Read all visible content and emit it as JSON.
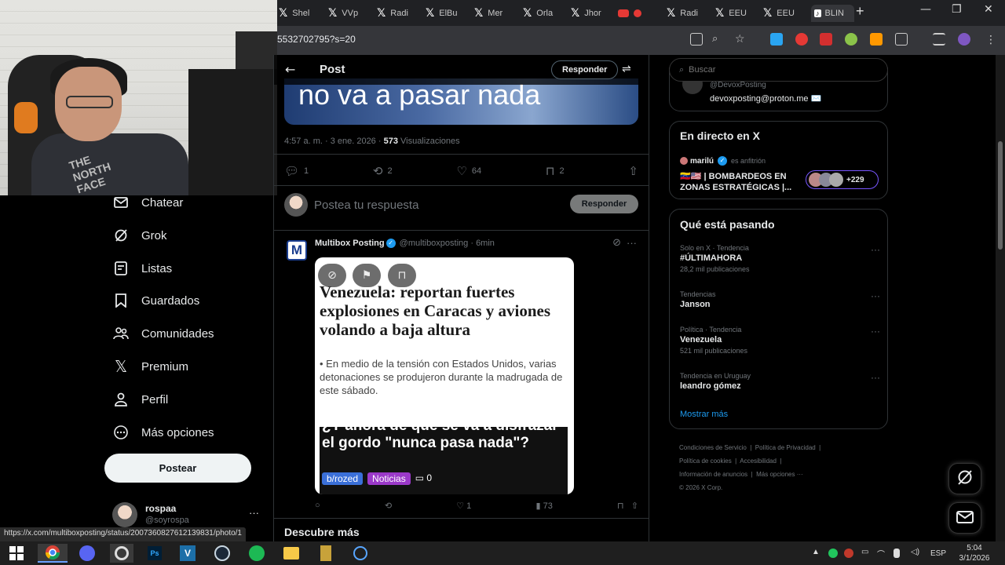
{
  "browser": {
    "tabs": [
      {
        "label": "Shel",
        "icon": "x"
      },
      {
        "label": "VVp",
        "icon": "x"
      },
      {
        "label": "Radi",
        "icon": "x"
      },
      {
        "label": "ElBu",
        "icon": "x"
      },
      {
        "label": "Mer",
        "icon": "x"
      },
      {
        "label": "Orla",
        "icon": "x"
      },
      {
        "label": "Jhor",
        "icon": "x"
      },
      {
        "label": "",
        "icon": "youtube"
      },
      {
        "label": "Radi",
        "icon": "x"
      },
      {
        "label": "EEU",
        "icon": "x"
      },
      {
        "label": "EEU",
        "icon": "x"
      },
      {
        "label": "BLIN",
        "icon": "tiktok"
      }
    ],
    "new_tab": "+",
    "url": "5532702795?s=20",
    "status_link": "https://x.com/multiboxposting/status/2007360827612139831/photo/1"
  },
  "nav": {
    "items": [
      {
        "label": "Chatear",
        "icon": "mail-icon"
      },
      {
        "label": "Grok",
        "icon": "grok-icon"
      },
      {
        "label": "Listas",
        "icon": "list-icon"
      },
      {
        "label": "Guardados",
        "icon": "bookmark-icon"
      },
      {
        "label": "Comunidades",
        "icon": "communities-icon"
      },
      {
        "label": "Premium",
        "icon": "x-logo-icon"
      },
      {
        "label": "Perfil",
        "icon": "person-icon"
      },
      {
        "label": "Más opciones",
        "icon": "more-icon"
      }
    ],
    "post_button": "Postear",
    "profile": {
      "name": "rospaa",
      "handle": "@soyrospa"
    }
  },
  "post": {
    "header_title": "Post",
    "header_reply": "Responder",
    "image_text": "no va a pasar nada",
    "meta_time": "4:57 a. m. · 3 ene. 2026 · ",
    "views_count": "573",
    "views_label": " Visualizaciones",
    "stats": {
      "replies": "1",
      "reposts": "2",
      "likes": "64",
      "bookmarks": "2"
    },
    "reply_placeholder": "Postea tu respuesta",
    "reply_button": "Responder"
  },
  "reply_tweet": {
    "author": "Multibox Posting",
    "handle": "@multiboxposting",
    "time": "· 6min",
    "avatar_letter": "M",
    "headline": "Venezuela: reportan fuertes explosiones en Caracas y aviones volando a baja altura",
    "lead": "• En medio de la tensión con Estados Unidos, varias detonaciones se produjeron durante la madrugada de este sábado.",
    "overlay_text": "¿Y ahora de que se va a disfrazar el gordo \"nunca pasa nada\"?",
    "tag1": "b/rozed",
    "tag2": "Noticias",
    "tag3": "0",
    "stats": {
      "replies": "",
      "reposts": "",
      "likes": "1",
      "views": "73"
    }
  },
  "descubre": "Descubre más",
  "sidebar": {
    "search_placeholder": "Buscar",
    "contact_handle": "@DevoxPosting",
    "contact_email": "devoxposting@proton.me ✉️",
    "live": {
      "title": "En directo en X",
      "host": "marilú",
      "host_suffix": "es anfitrión",
      "space_title": "🇻🇪🇺🇸 | BOMBARDEOS EN ZONAS ESTRATÉGICAS |...",
      "listeners": "+229"
    },
    "trending": {
      "title": "Qué está pasando",
      "items": [
        {
          "category": "Solo en X · Tendencia",
          "name": "#ÚLTIMAHORA",
          "count": "28,2 mil publicaciones"
        },
        {
          "category": "Tendencias",
          "name": "Janson",
          "count": ""
        },
        {
          "category": "Política · Tendencia",
          "name": "Venezuela",
          "count": "521 mil publicaciones"
        },
        {
          "category": "Tendencia en Uruguay",
          "name": "leandro gómez",
          "count": ""
        }
      ],
      "show_more": "Mostrar más"
    },
    "footer": {
      "l1": "Condiciones de Servicio",
      "l2": "Política de Privacidad",
      "l3": "Política de cookies",
      "l4": "Accesibilidad",
      "l5": "Información de anuncios",
      "l6": "Más opciones ···",
      "l7": "© 2026 X Corp."
    }
  },
  "taskbar": {
    "lang": "ESP",
    "time": "5:04",
    "date": "3/1/2026"
  },
  "colors": {
    "accent": "#1d9bf0",
    "bg": "#000000",
    "text": "#e7e9ea",
    "muted": "#71767b"
  }
}
